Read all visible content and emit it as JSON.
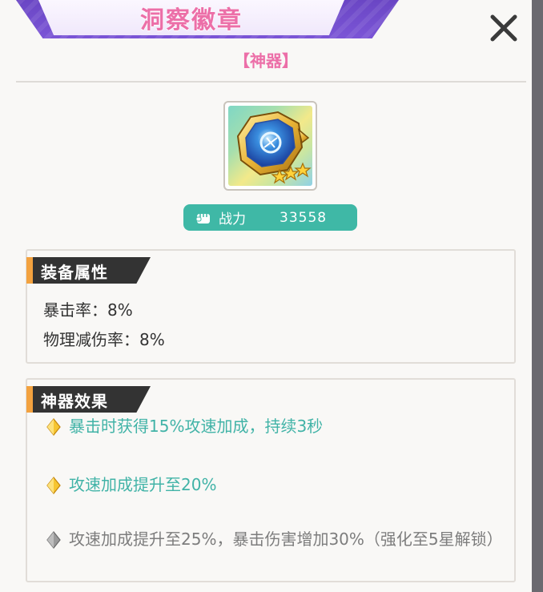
{
  "window": {
    "title": "洞察徽章",
    "rarity_tag": "【神器】"
  },
  "item": {
    "icon": "insight-badge-icon",
    "stars": 3
  },
  "power": {
    "label": "战力",
    "value": "33558"
  },
  "equip_attributes": {
    "header": "装备属性",
    "items": [
      "暴击率：8%",
      "物理减伤率：8%"
    ]
  },
  "artifact_effects": {
    "header": "神器效果",
    "items": [
      {
        "text": "暴击时获得15%攻速加成，持续3秒",
        "state": "active"
      },
      {
        "text": "攻速加成提升至20%",
        "state": "active"
      },
      {
        "text": "攻速加成提升至25%，暴击伤害增加30%（强化至5星解锁）",
        "state": "locked"
      }
    ]
  },
  "colors": {
    "title_pink": "#ec6fa8",
    "banner_purple": "#7b55d6",
    "teal": "#3fb8a6",
    "active_text": "#41b3a7",
    "locked_text": "#7d7d7d",
    "header_accent": "#f3a23f"
  }
}
